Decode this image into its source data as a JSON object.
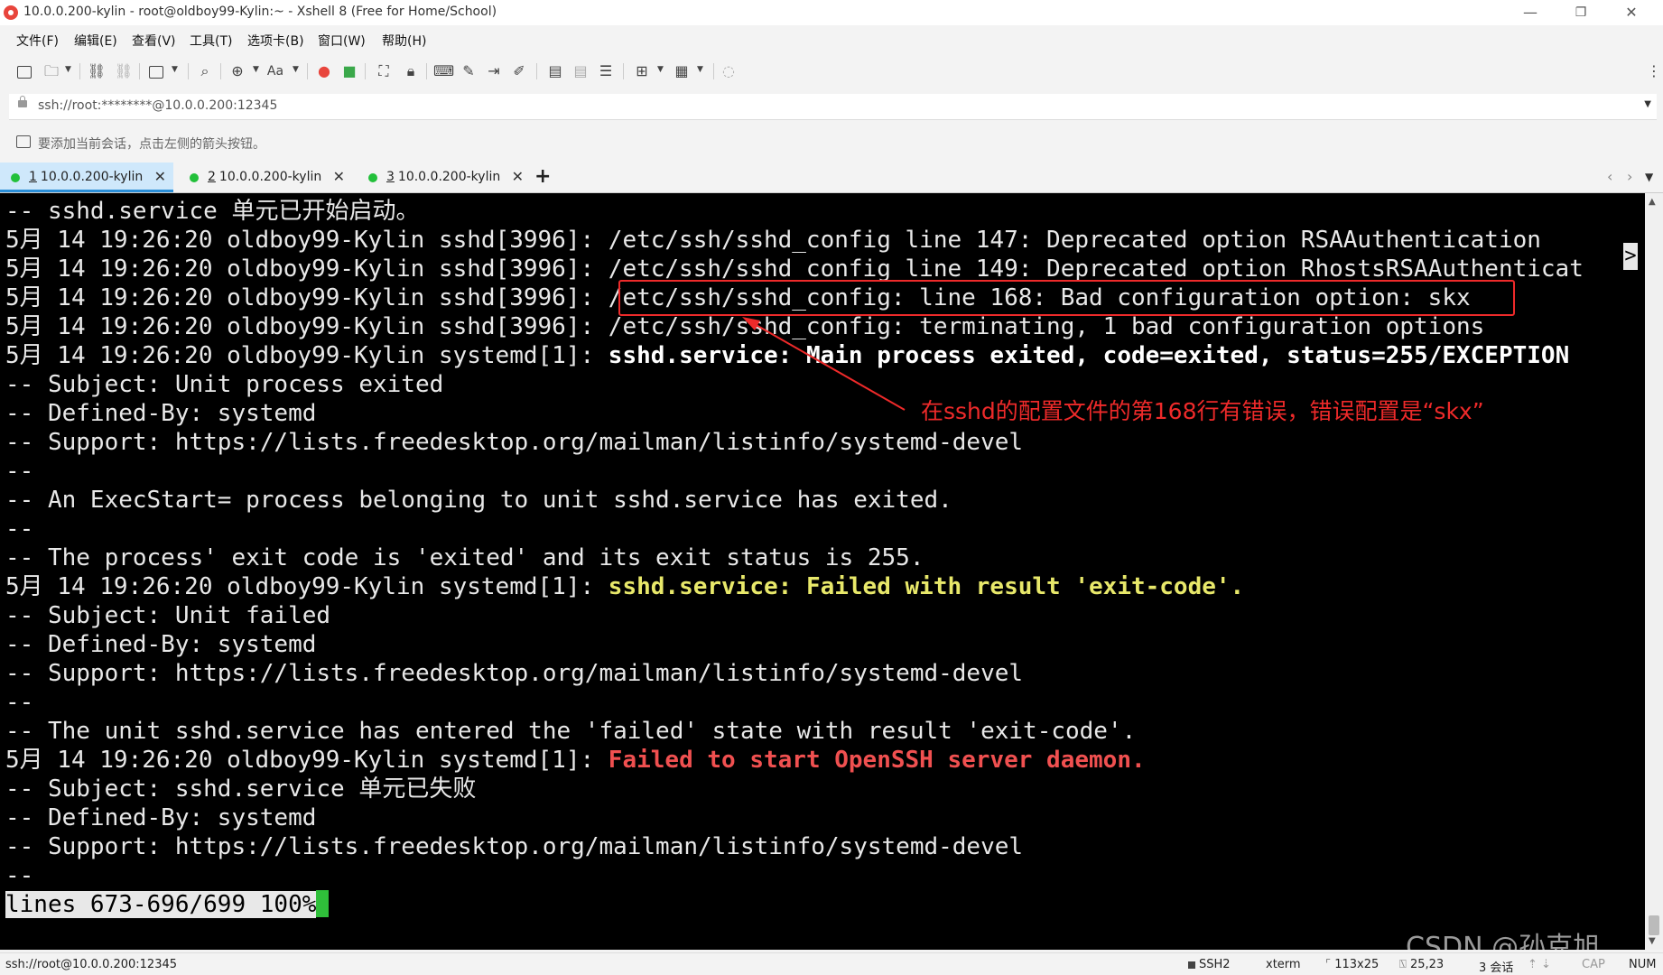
{
  "window": {
    "title": "10.0.0.200-kylin - root@oldboy99-Kylin:~ - Xshell 8 (Free for Home/School)",
    "minimize": "—",
    "restore": "❐",
    "close": "✕"
  },
  "menu": [
    "文件(F)",
    "编辑(E)",
    "查看(V)",
    "工具(T)",
    "选项卡(B)",
    "窗口(W)",
    "帮助(H)"
  ],
  "address": {
    "value": "ssh://root:********@10.0.0.200:12345"
  },
  "hint": "要添加当前会话，点击左侧的箭头按钮。",
  "tabs": [
    {
      "num": "1",
      "label": "10.0.0.200-kylin",
      "active": true
    },
    {
      "num": "2",
      "label": "10.0.0.200-kylin",
      "active": false
    },
    {
      "num": "3",
      "label": "10.0.0.200-kylin",
      "active": false
    }
  ],
  "terminal": {
    "lines": [
      {
        "text": "-- sshd.service 单元已开始启动。"
      },
      {
        "text": "5月 14 19:26:20 oldboy99-Kylin sshd[3996]: /etc/ssh/sshd_config line 147: Deprecated option RSAAuthentication"
      },
      {
        "text": "5月 14 19:26:20 oldboy99-Kylin sshd[3996]: /etc/ssh/sshd_config line 149: Deprecated option RhostsRSAAuthenticat"
      },
      {
        "text": "5月 14 19:26:20 oldboy99-Kylin sshd[3996]: /etc/ssh/sshd_config: line 168: Bad configuration option: skx"
      },
      {
        "text": "5月 14 19:26:20 oldboy99-Kylin sshd[3996]: /etc/ssh/sshd_config: terminating, 1 bad configuration options"
      },
      {
        "prefix": "5月 14 19:26:20 oldboy99-Kylin systemd[1]: ",
        "highlight": "sshd.service: Main process exited, code=exited, status=255/EXCEPTION",
        "style": "white"
      },
      {
        "text": "-- Subject: Unit process exited"
      },
      {
        "text": "-- Defined-By: systemd"
      },
      {
        "text": "-- Support: https://lists.freedesktop.org/mailman/listinfo/systemd-devel"
      },
      {
        "text": "--"
      },
      {
        "text": "-- An ExecStart= process belonging to unit sshd.service has exited."
      },
      {
        "text": "--"
      },
      {
        "text": "-- The process' exit code is 'exited' and its exit status is 255."
      },
      {
        "prefix": "5月 14 19:26:20 oldboy99-Kylin systemd[1]: ",
        "highlight": "sshd.service: Failed with result 'exit-code'.",
        "style": "yellow"
      },
      {
        "text": "-- Subject: Unit failed"
      },
      {
        "text": "-- Defined-By: systemd"
      },
      {
        "text": "-- Support: https://lists.freedesktop.org/mailman/listinfo/systemd-devel"
      },
      {
        "text": "--"
      },
      {
        "text": "-- The unit sshd.service has entered the 'failed' state with result 'exit-code'."
      },
      {
        "prefix": "5月 14 19:26:20 oldboy99-Kylin systemd[1]: ",
        "highlight": "Failed to start OpenSSH server daemon.",
        "style": "red"
      },
      {
        "text": "-- Subject: sshd.service 单元已失败"
      },
      {
        "text": "-- Defined-By: systemd"
      },
      {
        "text": "-- Support: https://lists.freedesktop.org/mailman/listinfo/systemd-devel"
      },
      {
        "text": "--"
      }
    ],
    "pager": "lines 673-696/699 100%",
    "overflow_mark": ">",
    "annotation": "在sshd的配置文件的第168行有错误，错误配置是“skx”",
    "watermark": "CSDN @孙克旭"
  },
  "status": {
    "connection": "ssh://root@10.0.0.200:12345",
    "protocol": "SSH2",
    "term": "xterm",
    "size": "113x25",
    "cursor_pos": "25,23",
    "sessions": "3 会话",
    "cap": "CAP",
    "num": "NUM"
  },
  "colors": {
    "tab_active": "#cfe8fb",
    "status_dot": "#22c03a",
    "annotation_red": "#ee2a2a",
    "term_yellow": "#e8e86a",
    "term_red": "#f05050",
    "cursor_green": "#2fbf3a"
  }
}
